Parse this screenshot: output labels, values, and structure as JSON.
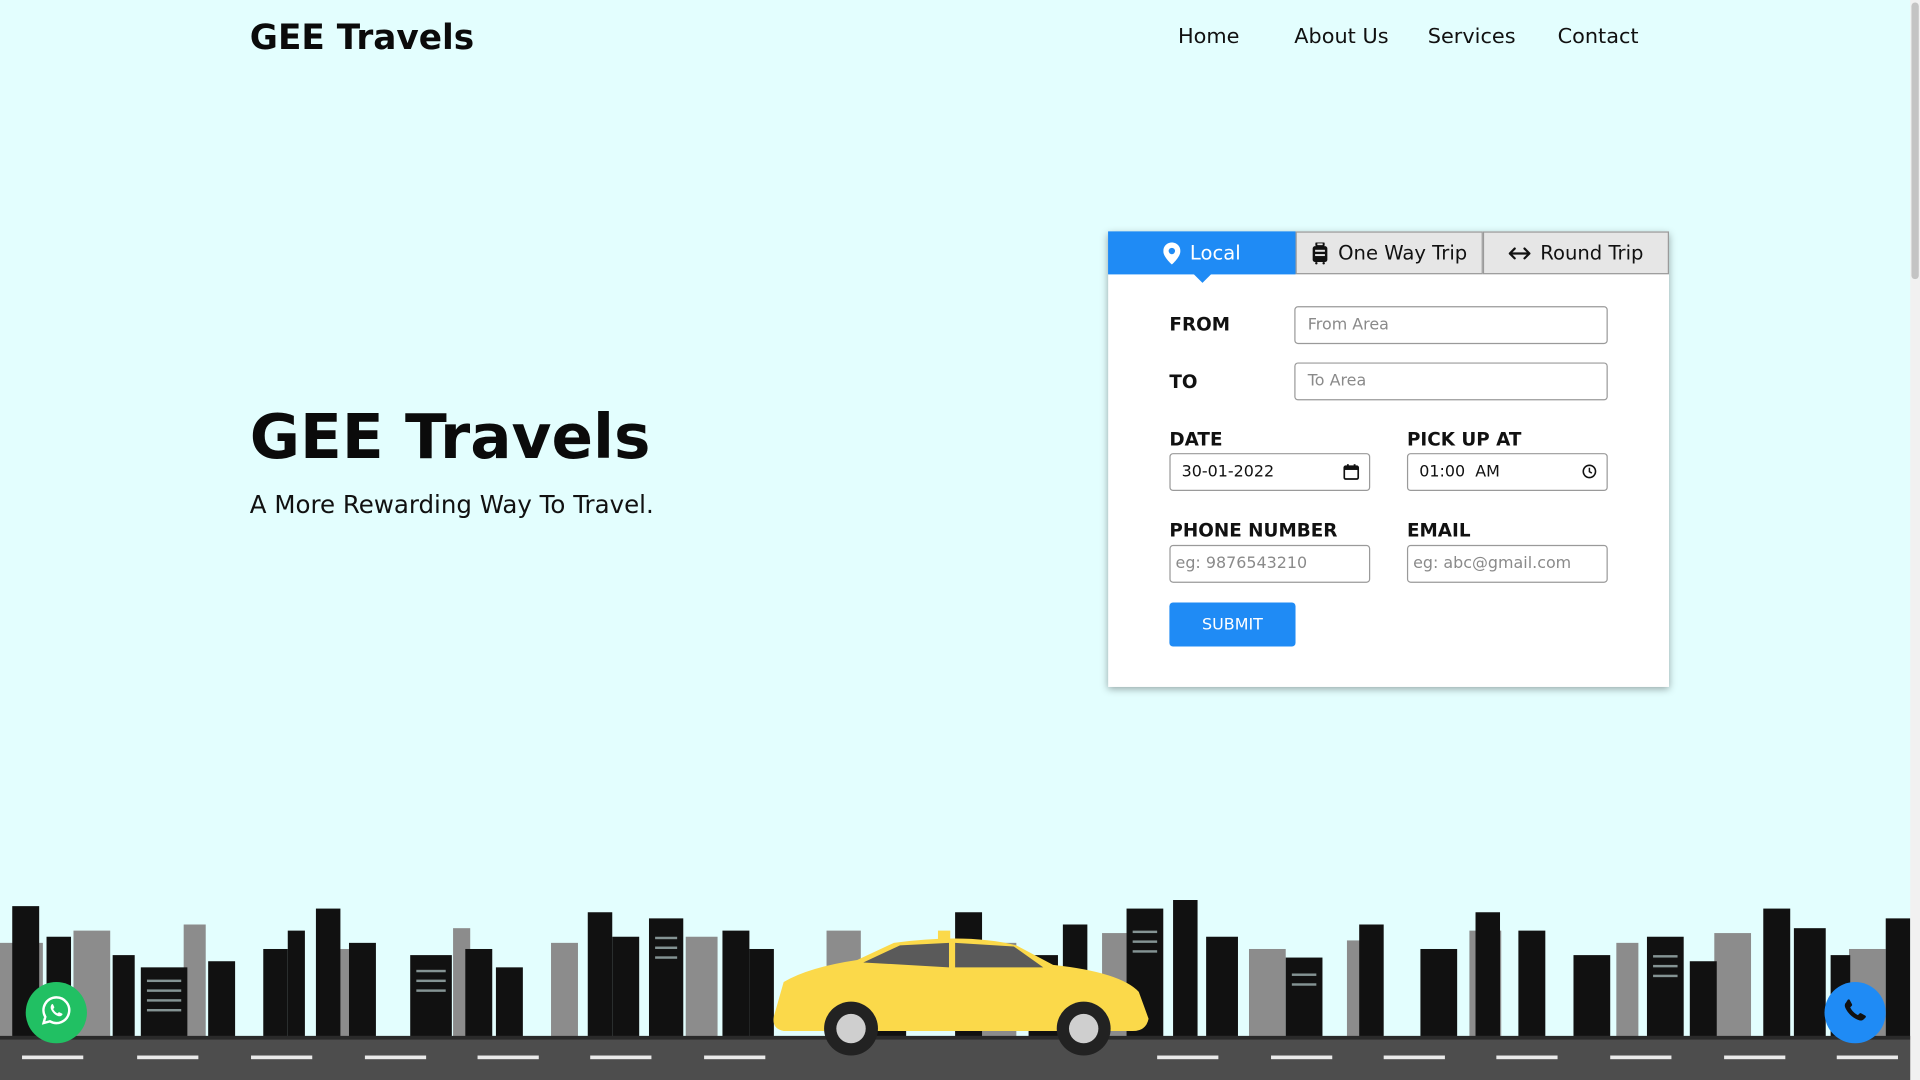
{
  "header": {
    "brand": "GEE Travels",
    "nav": [
      "Home",
      "About Us",
      "Services",
      "Contact"
    ]
  },
  "hero": {
    "title": "GEE Travels",
    "subtitle": "A More Rewarding Way To Travel."
  },
  "booking": {
    "tabs": [
      {
        "label": "Local",
        "icon": "map-pin-icon",
        "active": true
      },
      {
        "label": "One Way Trip",
        "icon": "luggage-icon",
        "active": false
      },
      {
        "label": "Round Trip",
        "icon": "arrows-left-right-icon",
        "active": false
      }
    ],
    "from_label": "FROM",
    "from_placeholder": "From Area",
    "to_label": "TO",
    "to_placeholder": "To Area",
    "date_label": "DATE",
    "date_value": "30-01-2022",
    "pickup_label": "PICK UP AT",
    "pickup_value": "01:00  AM",
    "phone_label": "PHONE NUMBER",
    "phone_placeholder": "eg: 9876543210",
    "email_label": "EMAIL",
    "email_placeholder": "eg: abc@gmail.com",
    "submit_label": "SUBMIT"
  },
  "floating": {
    "whatsapp_icon": "whatsapp-icon",
    "phone_icon": "phone-icon"
  },
  "colors": {
    "background": "#e3fefe",
    "accent": "#1f8bf5",
    "whatsapp": "#21c063",
    "taxi": "#fbd94a"
  }
}
